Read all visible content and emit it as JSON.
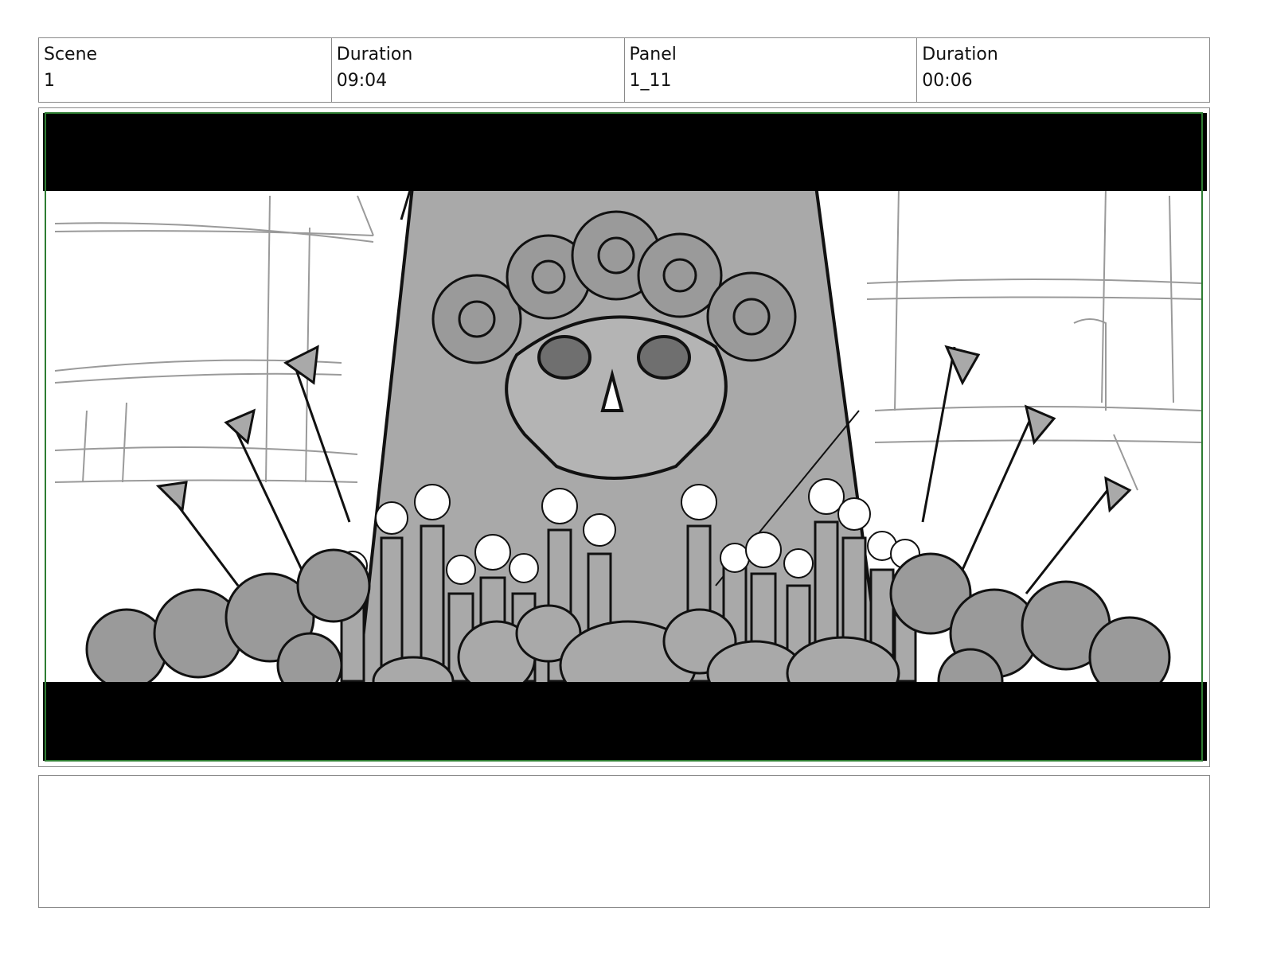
{
  "header": {
    "scene_label": "Scene",
    "scene_value": "1",
    "scene_duration_label": "Duration",
    "scene_duration_value": "09:04",
    "panel_label": "Panel",
    "panel_value": "1_11",
    "panel_duration_label": "Duration",
    "panel_duration_value": "00:06"
  },
  "panel_image": {
    "subject": "sketch-gravestone-skull-candles-arrows-flowers",
    "colors": {
      "letterbox": "#000000",
      "safe_frame": "#2e7d32",
      "stone": "#a9a9a9",
      "ink": "#111111"
    }
  },
  "notes": {
    "text": ""
  }
}
